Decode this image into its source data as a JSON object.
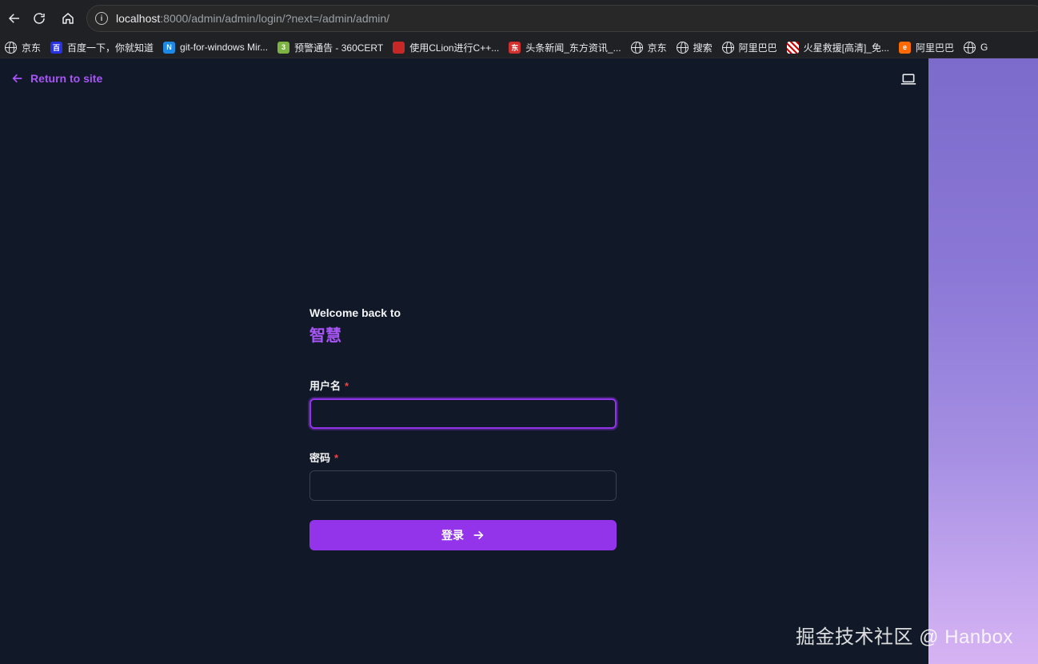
{
  "browser": {
    "url_host": "localhost",
    "url_rest": ":8000/admin/admin/login/?next=/admin/admin/",
    "bookmarks": [
      {
        "label": "京东",
        "icon": "globe-icon",
        "color": "#e8eaed"
      },
      {
        "label": "百度一下，你就知道",
        "icon": "baidu-icon",
        "color": "#2932e1"
      },
      {
        "label": "git-for-windows Mir...",
        "icon": "n-icon",
        "color": "#1e88e5"
      },
      {
        "label": "预警通告 - 360CERT",
        "icon": "360-icon",
        "color": "#7cb342"
      },
      {
        "label": "使用CLion进行C++...",
        "icon": "red-icon",
        "color": "#c62828"
      },
      {
        "label": "头条新闻_东方资讯_...",
        "icon": "dongfang-icon",
        "color": "#d32f2f"
      },
      {
        "label": "京东",
        "icon": "globe-icon",
        "color": "#e8eaed"
      },
      {
        "label": "搜索",
        "icon": "globe-icon",
        "color": "#e8eaed"
      },
      {
        "label": "阿里巴巴",
        "icon": "globe-icon",
        "color": "#e8eaed"
      },
      {
        "label": "火星救援[高清]_免...",
        "icon": "image-icon",
        "color": "#ffffff"
      },
      {
        "label": "阿里巴巴",
        "icon": "alibaba-icon",
        "color": "#ff6a00"
      },
      {
        "label": "G",
        "icon": "globe-icon",
        "color": "#e8eaed"
      }
    ]
  },
  "page": {
    "return_label": "Return to site",
    "welcome": "Welcome back to",
    "site_name": "智慧",
    "username_label": "用户名",
    "password_label": "密码",
    "required_mark": "*",
    "username_value": "",
    "password_value": "",
    "submit_label": "登录"
  },
  "watermark": "掘金技术社区 @ Hanbox",
  "colors": {
    "accent": "#9333ea",
    "link": "#a855f7",
    "background": "#111827",
    "required": "#ef4444"
  }
}
